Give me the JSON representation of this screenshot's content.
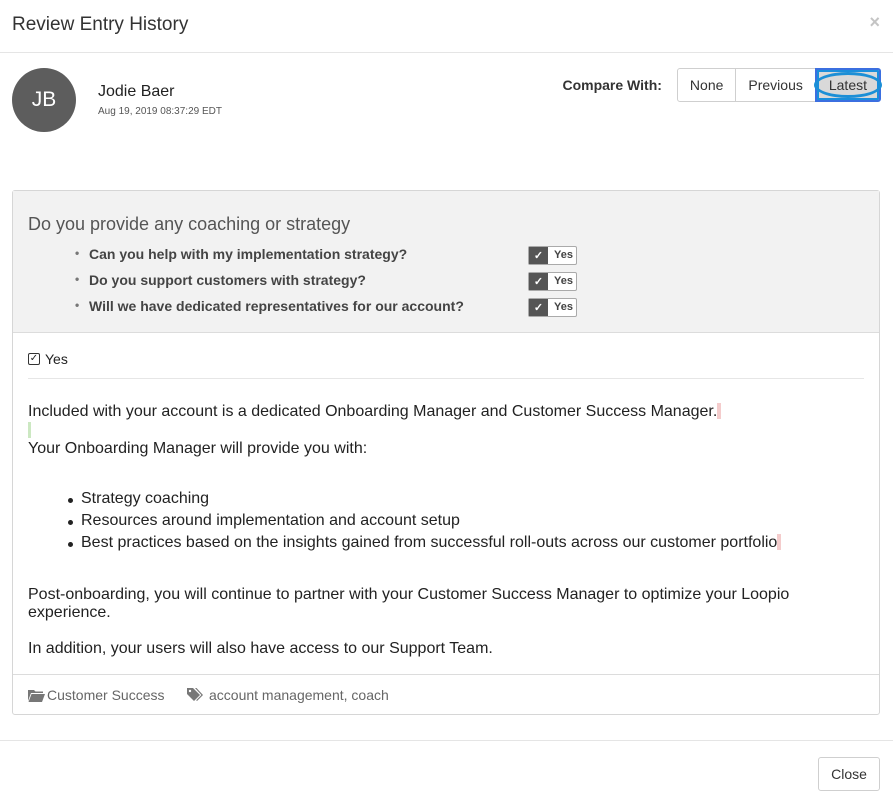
{
  "modal": {
    "title": "Review Entry History",
    "close_icon": "×"
  },
  "author": {
    "initials": "JB",
    "name": "Jodie Baer",
    "date": "Aug 19, 2019 08:37:29 EDT"
  },
  "compare": {
    "label": "Compare With:",
    "options": [
      "None",
      "Previous",
      "Latest"
    ],
    "selected": "Latest"
  },
  "question": {
    "title": "Do you provide any coaching or strategy",
    "items": [
      {
        "text": "Can you help with my implementation strategy?",
        "badge": "Yes"
      },
      {
        "text": "Do you support customers with strategy?",
        "badge": "Yes"
      },
      {
        "text": "Will we have dedicated representatives for our account?",
        "badge": "Yes"
      }
    ]
  },
  "answer": {
    "checkbox_label": "Yes",
    "para1": "Included with your account is a dedicated Onboarding Manager and Customer Success Manager.",
    "para2": "Your Onboarding Manager will provide you with:",
    "bullets": [
      "Strategy coaching",
      "Resources around implementation and account setup",
      "Best practices based on the insights gained from successful roll-outs across our customer portfolio"
    ],
    "para3": "Post-onboarding, you will continue to partner with your Customer Success Manager to optimize your Loopio experience.",
    "para4": "In addition, your users will also have access to our Support Team."
  },
  "meta": {
    "folder": "Customer Success",
    "tags": "account management, coach"
  },
  "footer": {
    "close_label": "Close"
  },
  "colors": {
    "accent": "#1c8fd6",
    "avatar": "#5d5d5d",
    "deletion": "#f4cccc",
    "insertion": "#cce8c2"
  }
}
